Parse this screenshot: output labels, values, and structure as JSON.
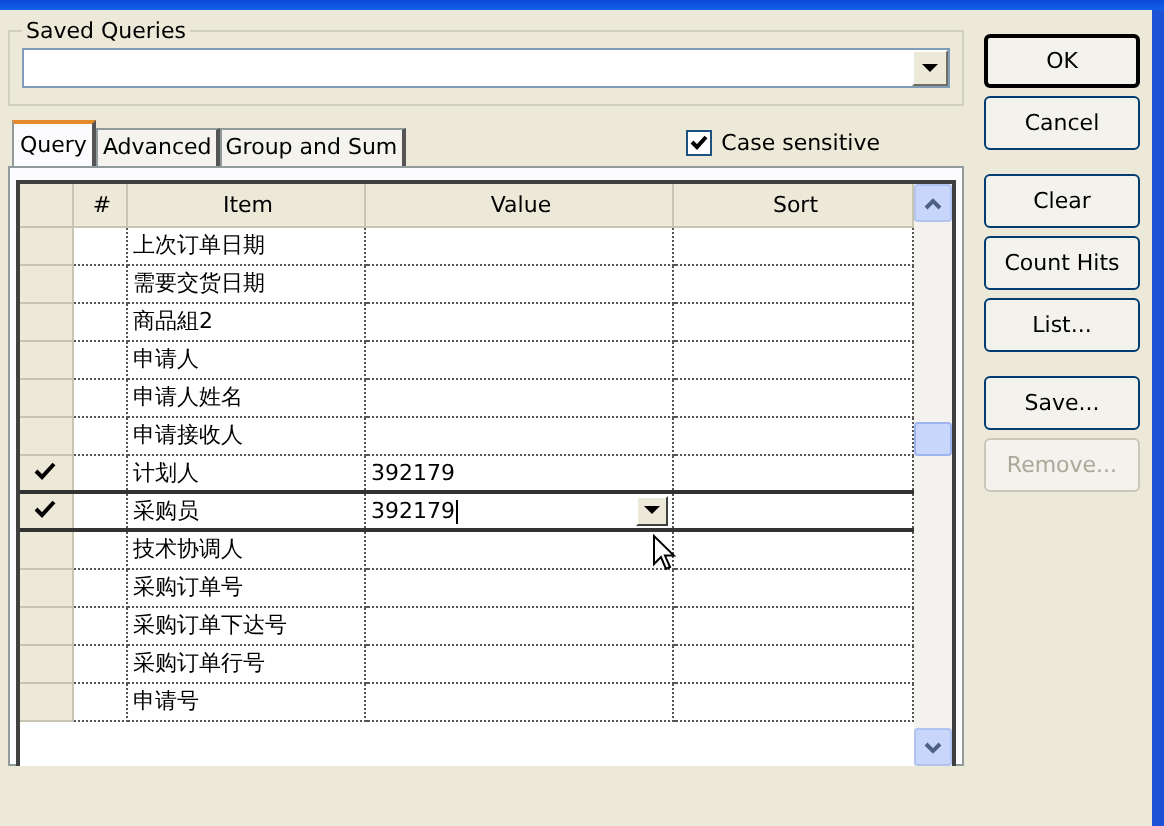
{
  "saved_queries": {
    "label": "Saved Queries"
  },
  "tabs": [
    {
      "label": "Query",
      "selected": true
    },
    {
      "label": "Advanced",
      "selected": false
    },
    {
      "label": "Group and Sum",
      "selected": false
    }
  ],
  "case_sensitive": {
    "label": "Case sensitive",
    "checked": true
  },
  "grid": {
    "columns": [
      "#",
      "Item",
      "Value",
      "Sort"
    ],
    "rows": [
      {
        "item": "上次订单日期",
        "value": "",
        "checked": false,
        "current": false
      },
      {
        "item": "需要交货日期",
        "value": "",
        "checked": false,
        "current": false
      },
      {
        "item": "商品組2",
        "value": "",
        "checked": false,
        "current": false
      },
      {
        "item": "申请人",
        "value": "",
        "checked": false,
        "current": false
      },
      {
        "item": "申请人姓名",
        "value": "",
        "checked": false,
        "current": false
      },
      {
        "item": "申请接收人",
        "value": "",
        "checked": false,
        "current": false
      },
      {
        "item": "计划人",
        "value": "392179",
        "checked": true,
        "current": false
      },
      {
        "item": "采购员",
        "value": "392179",
        "checked": true,
        "current": true
      },
      {
        "item": "技术协调人",
        "value": "",
        "checked": false,
        "current": false
      },
      {
        "item": "采购订单号",
        "value": "",
        "checked": false,
        "current": false
      },
      {
        "item": "采购订单下达号",
        "value": "",
        "checked": false,
        "current": false
      },
      {
        "item": "采购订单行号",
        "value": "",
        "checked": false,
        "current": false
      },
      {
        "item": "申请号",
        "value": "",
        "checked": false,
        "current": false
      }
    ]
  },
  "button_groups": [
    [
      {
        "label": "OK",
        "disabled": false,
        "default": true
      },
      {
        "label": "Cancel",
        "disabled": false,
        "default": false
      }
    ],
    [
      {
        "label": "Clear",
        "disabled": false,
        "default": false
      },
      {
        "label": "Count Hits",
        "disabled": false,
        "default": false
      },
      {
        "label": "List...",
        "disabled": false,
        "default": false
      }
    ],
    [
      {
        "label": "Save...",
        "disabled": false,
        "default": false
      },
      {
        "label": "Remove...",
        "disabled": true,
        "default": false
      }
    ]
  ]
}
